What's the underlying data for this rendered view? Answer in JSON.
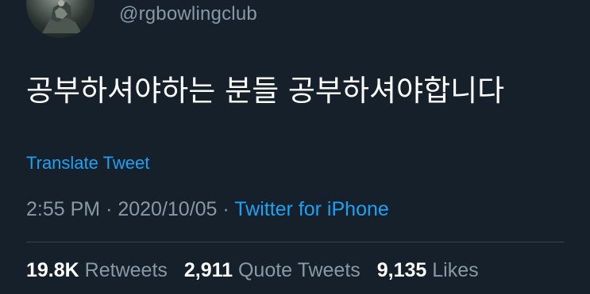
{
  "tweet": {
    "handle": "@rgbowlingclub",
    "text": "공부하셔야하는 분들 공부하셔야합니다",
    "translate_label": "Translate Tweet",
    "time": "2:55 PM",
    "separator": "·",
    "date": "2020/10/05",
    "source": "Twitter for iPhone",
    "stats": {
      "retweets": {
        "count": "19.8K",
        "label": "Retweets"
      },
      "quote_tweets": {
        "count": "2,911",
        "label": "Quote Tweets"
      },
      "likes": {
        "count": "9,135",
        "label": "Likes"
      }
    }
  },
  "colors": {
    "background": "#15202b",
    "text_primary": "#ffffff",
    "text_secondary": "#8899a6",
    "link": "#1da1f2",
    "divider": "#38444d"
  },
  "icons": {
    "avatar": "profile-avatar-image"
  }
}
